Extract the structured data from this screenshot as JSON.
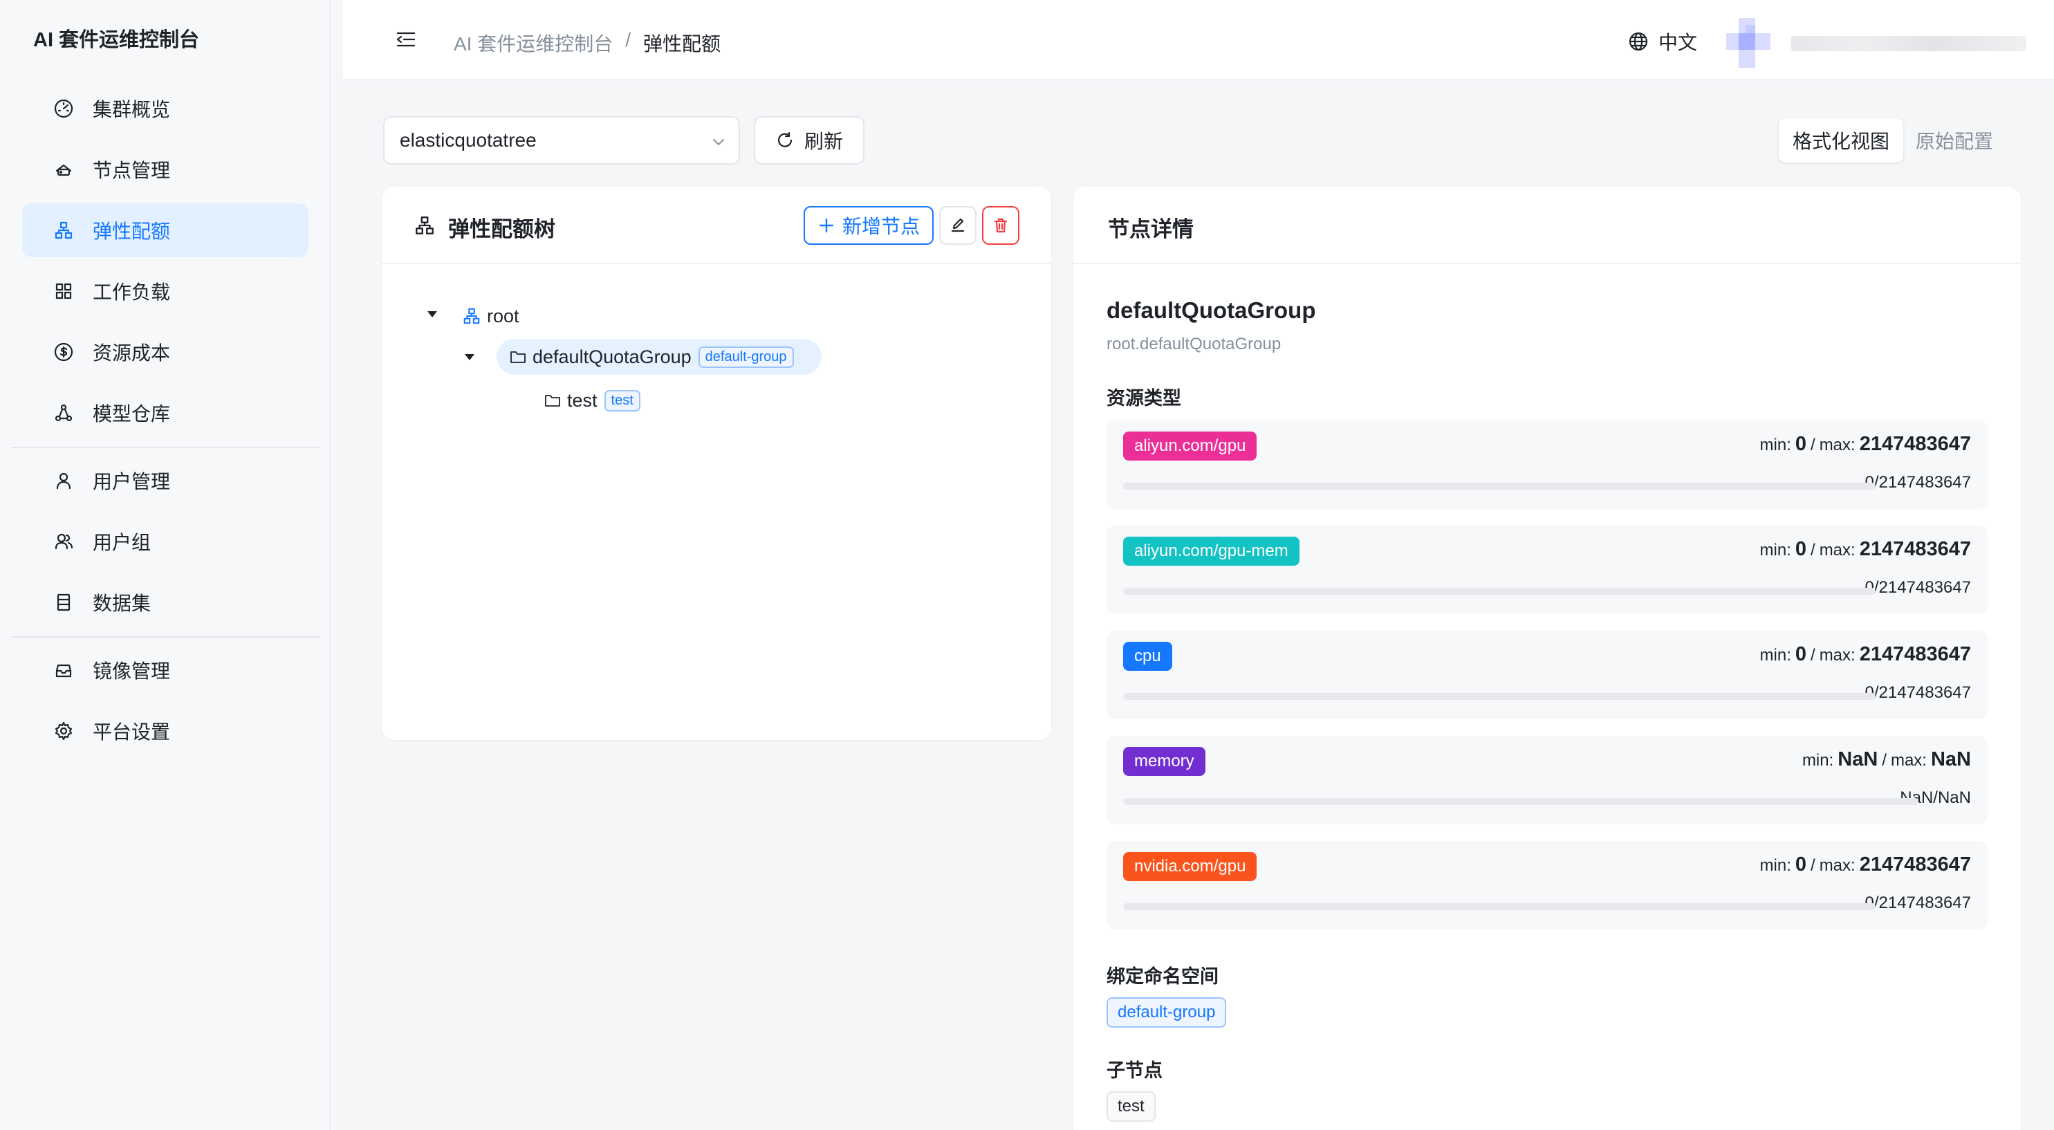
{
  "app": {
    "title": "AI 套件运维控制台"
  },
  "sidebar": {
    "items": [
      {
        "label": "集群概览",
        "icon": "dashboard-icon"
      },
      {
        "label": "节点管理",
        "icon": "node-icon"
      },
      {
        "label": "弹性配额",
        "icon": "quota-tree-icon",
        "active": true
      },
      {
        "label": "工作负载",
        "icon": "grid-icon"
      },
      {
        "label": "资源成本",
        "icon": "dollar-icon"
      },
      {
        "label": "模型仓库",
        "icon": "model-icon"
      },
      {
        "label": "用户管理",
        "icon": "user-icon"
      },
      {
        "label": "用户组",
        "icon": "user-group-icon"
      },
      {
        "label": "数据集",
        "icon": "dataset-icon"
      },
      {
        "label": "镜像管理",
        "icon": "image-icon"
      },
      {
        "label": "平台设置",
        "icon": "settings-icon"
      }
    ]
  },
  "header": {
    "breadcrumb": [
      "AI 套件运维控制台",
      "/",
      "弹性配额"
    ],
    "language": "中文"
  },
  "toolbar": {
    "tree_select_value": "elasticquotatree",
    "refresh_label": "刷新",
    "view_formatted": "格式化视图",
    "view_raw": "原始配置"
  },
  "tree_panel": {
    "title": "弹性配额树",
    "add_node_label": "新增节点",
    "nodes": {
      "root": {
        "label": "root"
      },
      "default_group": {
        "label": "defaultQuotaGroup",
        "tag": "default-group"
      },
      "test": {
        "label": "test",
        "tag": "test"
      }
    }
  },
  "detail_panel": {
    "title": "节点详情",
    "node_name": "defaultQuotaGroup",
    "node_path": "root.defaultQuotaGroup",
    "resource_types_label": "资源类型",
    "min_label": "min:",
    "max_label": "max:",
    "resources": [
      {
        "name": "aliyun.com/gpu",
        "color": "#eb2f96",
        "min": "0",
        "max": "2147483647",
        "usage": "0/2147483647",
        "fill": 0
      },
      {
        "name": "aliyun.com/gpu-mem",
        "color": "#13c2c2",
        "min": "0",
        "max": "2147483647",
        "usage": "0/2147483647",
        "fill": 0
      },
      {
        "name": "cpu",
        "color": "#1677ff",
        "min": "0",
        "max": "2147483647",
        "usage": "0/2147483647",
        "fill": 0
      },
      {
        "name": "memory",
        "color": "#722ed1",
        "min": "NaN",
        "max": "NaN",
        "usage": "NaN/NaN",
        "fill": 0
      },
      {
        "name": "nvidia.com/gpu",
        "color": "#fa541c",
        "min": "0",
        "max": "2147483647",
        "usage": "0/2147483647",
        "fill": 0
      }
    ],
    "namespace_label": "绑定命名空间",
    "namespace_value": "default-group",
    "children_label": "子节点",
    "children": [
      "test"
    ]
  },
  "colors": {
    "accent": "#1677ff",
    "danger": "#f53f3f"
  }
}
